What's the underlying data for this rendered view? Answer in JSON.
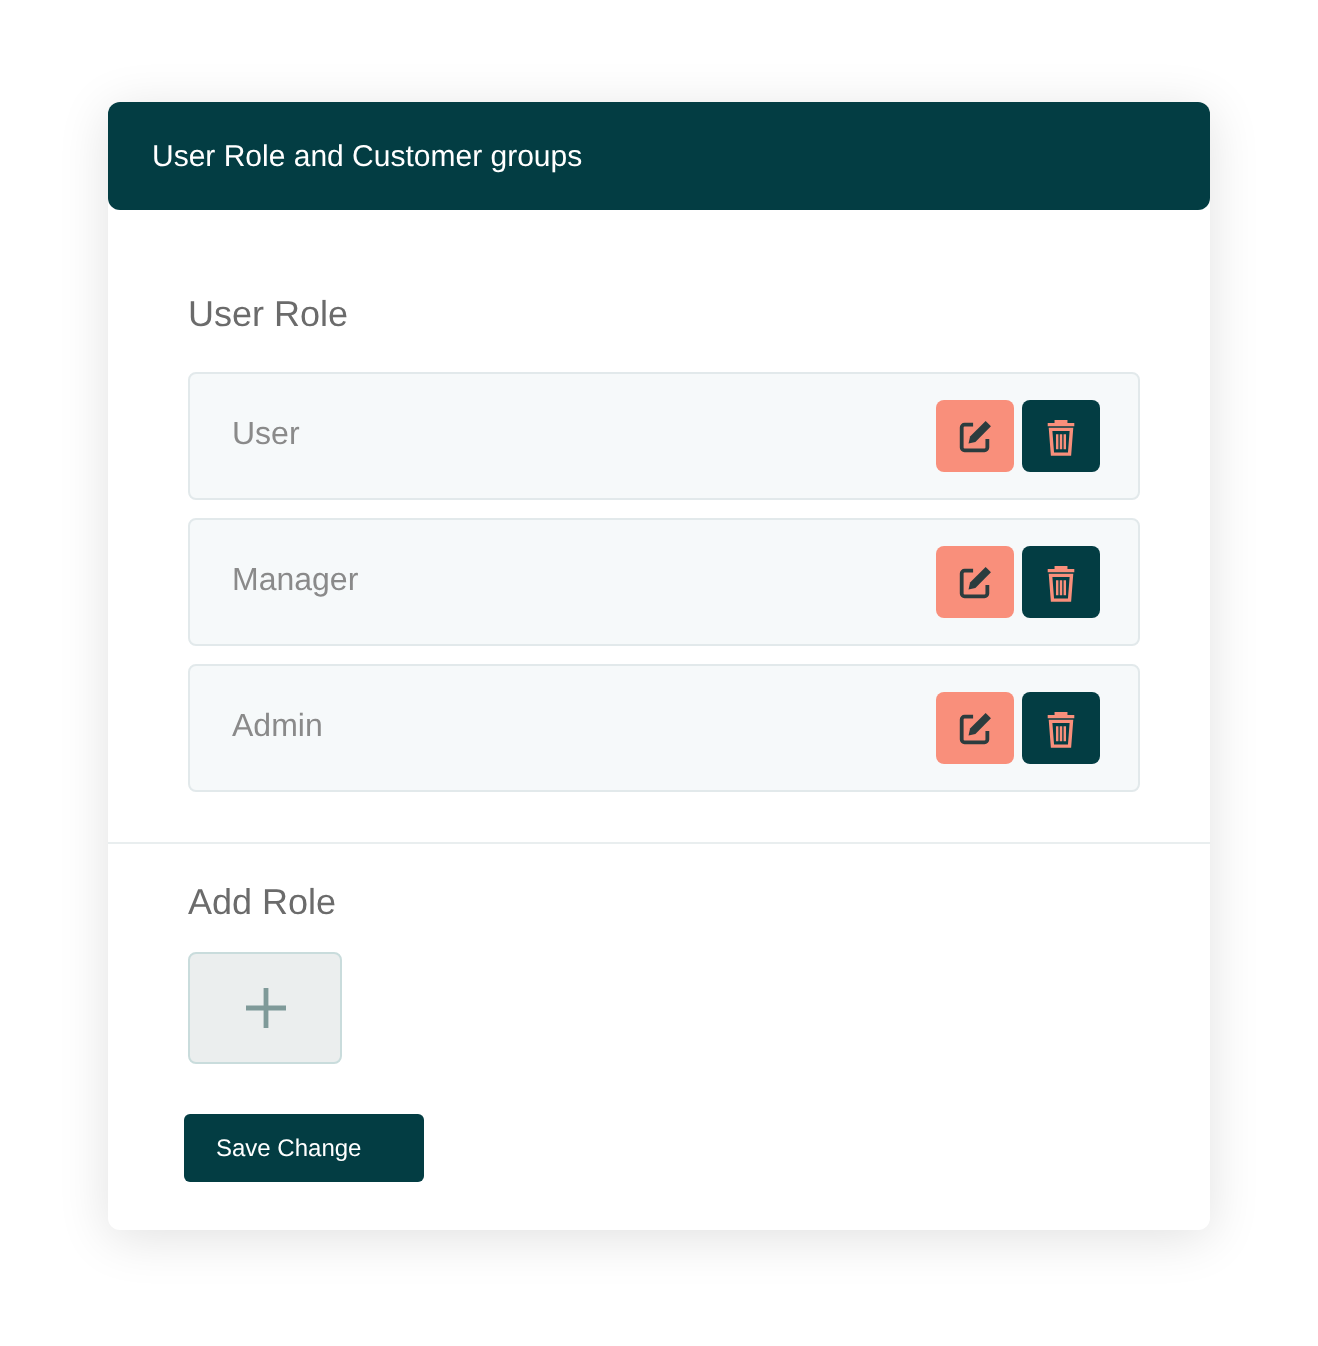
{
  "card": {
    "title": "User Role and Customer groups"
  },
  "user_role": {
    "heading": "User Role",
    "roles": [
      {
        "name": "User"
      },
      {
        "name": "Manager"
      },
      {
        "name": "Admin"
      }
    ]
  },
  "add_role": {
    "heading": "Add Role"
  },
  "save_button": {
    "label": "Save Change"
  }
}
